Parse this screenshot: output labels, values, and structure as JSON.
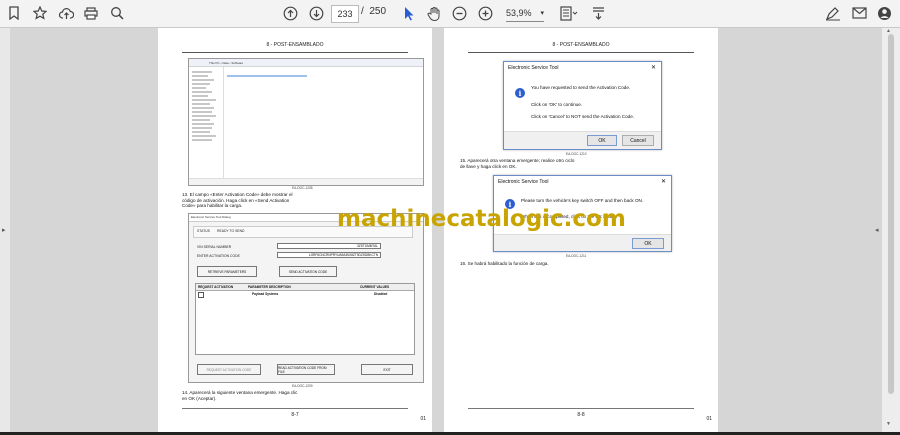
{
  "toolbar": {
    "current_page": "233",
    "page_separator": "/",
    "total_pages": "250",
    "zoom": "53,9%"
  },
  "left_page": {
    "header": "8 - POST-ENSAMBLADO",
    "explorer_path": "This PC › Data › Software",
    "caption_1": "EA-DOC-1208",
    "step_13_lines": [
      "13.  El campo «Enter Activation Code» debe mostrar el",
      "código de activación. Haga click en «Send Activation",
      "Code» para habilitar la carga."
    ],
    "est_window": {
      "title": "Electronic Service Tool Dialog",
      "status_label": "STATUS",
      "status_value": "READY TO SEND",
      "vin_label": "VIN SERIAL NUMBER",
      "vin_value": "3ZSTUMMTAL",
      "code_label": "ENTER ACTIVATION CODE",
      "code_value": "LGRF6CNCRNPRYUA9A35X8ZT9DZSDBKCTN",
      "retrieve_btn": "RETRIEVE PARAMETERS",
      "send_btn": "SEND ACTIVATION CODE",
      "col_request": "REQUEST ACTIVATION",
      "col_param": "PARAMETER DESCRIPTION",
      "col_current": "CURRENT VALUES",
      "row_param": "Payload Systems",
      "row_value": "Disabled",
      "bottom_btn_1": "REQUEST ACTIVATION CODE",
      "bottom_btn_2": "READ ACTIVATION CODE FROM FILE",
      "bottom_btn_3": "EXIT"
    },
    "caption_2": "EA-DOC-1209",
    "step_14_lines": [
      "14.  Aparecerá la siguiente ventana emergente. Haga clic",
      "en OK (Aceptar)."
    ],
    "footer": "8-7",
    "footer_right": "01"
  },
  "right_page": {
    "header": "8 - POST-ENSAMBLADO",
    "dialog_1": {
      "title": "Electronic Service Tool",
      "close": "✕",
      "line_1": "You have requested to send the Activation Code.",
      "line_2": "Click on 'OK' to continue.",
      "line_3": "Click on 'Cancel' to NOT send the Activation Code.",
      "ok": "OK",
      "cancel": "Cancel"
    },
    "caption_1": "EA-DOC-1210",
    "step_15_lines": [
      "15.  Aparecerá otra ventana emergente; realice otro ciclo",
      "de llave y haga click en OK."
    ],
    "dialog_2": {
      "title": "Electronic Service Tool",
      "close": "✕",
      "line_1": "Please turn the vehicle's key switch OFF and then back ON.",
      "line_2": "When this is completed, click on the OK button.",
      "ok": "OK"
    },
    "caption_2": "EA-DOC-1211",
    "step_16": "16.  Se habrá habilitado la función de carga.",
    "footer": "8-8",
    "footer_right": "01"
  },
  "watermark": "machinecatalogic.com",
  "colors": {
    "accent": "#2b5fcf",
    "watermark": "#c9a400"
  }
}
